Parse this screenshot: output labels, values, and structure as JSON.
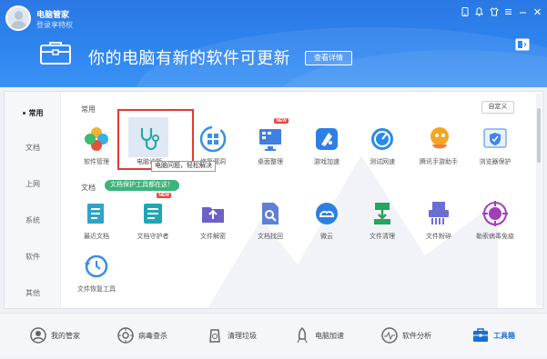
{
  "header": {
    "app_title": "电脑管家",
    "user_link": "登录享特权",
    "headline": "你的电脑有新的软件可更新",
    "detail_button": "查看详情"
  },
  "nav": {
    "items": [
      {
        "label": "常用",
        "active": true
      },
      {
        "label": "文档"
      },
      {
        "label": "上网"
      },
      {
        "label": "系统"
      },
      {
        "label": "软件"
      },
      {
        "label": "其他"
      }
    ]
  },
  "content": {
    "custom_button": "自定义",
    "sections": [
      {
        "title": "常用",
        "tools": [
          {
            "label": "软件管理",
            "icon": "software-manager-icon"
          },
          {
            "label": "电脑诊所",
            "icon": "stethoscope-icon"
          },
          {
            "label": "修复漏洞",
            "icon": "windows-repair-icon"
          },
          {
            "label": "桌面整理",
            "icon": "desktop-organize-icon",
            "badge": "NEW"
          },
          {
            "label": "游戏加速",
            "icon": "game-boost-icon"
          },
          {
            "label": "测试网速",
            "icon": "speed-test-icon"
          },
          {
            "label": "腾讯手游助手",
            "icon": "mobile-game-icon"
          },
          {
            "label": "浏览器保护",
            "icon": "browser-protect-icon"
          }
        ]
      },
      {
        "title": "文档",
        "banner": "文档保护工具都在这！",
        "tools": [
          {
            "label": "最近文档",
            "icon": "recent-docs-icon"
          },
          {
            "label": "文档守护者",
            "icon": "doc-guardian-icon",
            "badge": "NEW"
          },
          {
            "label": "文件解密",
            "icon": "file-decrypt-icon"
          },
          {
            "label": "文档找回",
            "icon": "doc-recover-icon"
          },
          {
            "label": "微云",
            "icon": "weiyun-icon"
          },
          {
            "label": "文件清理",
            "icon": "file-clean-icon"
          },
          {
            "label": "文件粉碎",
            "icon": "file-shred-icon"
          },
          {
            "label": "勒索病毒免疫",
            "icon": "ransomware-immune-icon"
          }
        ]
      }
    ],
    "extra_tool": {
      "label": "文件恢复工具",
      "icon": "file-restore-icon"
    },
    "tooltip": "电脑问题，轻松解决"
  },
  "bottom_tabs": [
    {
      "label": "我的管家",
      "icon": "my-manager-icon"
    },
    {
      "label": "病毒查杀",
      "icon": "virus-scan-icon"
    },
    {
      "label": "清理垃圾",
      "icon": "clean-junk-icon"
    },
    {
      "label": "电脑加速",
      "icon": "speed-up-icon"
    },
    {
      "label": "软件分析",
      "icon": "software-analysis-icon"
    },
    {
      "label": "工具箱",
      "icon": "toolbox-icon",
      "active": true
    }
  ],
  "colors": {
    "header_blue": "#2f86f0",
    "accent_blue": "#1a6fd6",
    "selection_red": "#e13a35",
    "banner_green": "#3bb47a",
    "badge_red": "#e8443b"
  }
}
